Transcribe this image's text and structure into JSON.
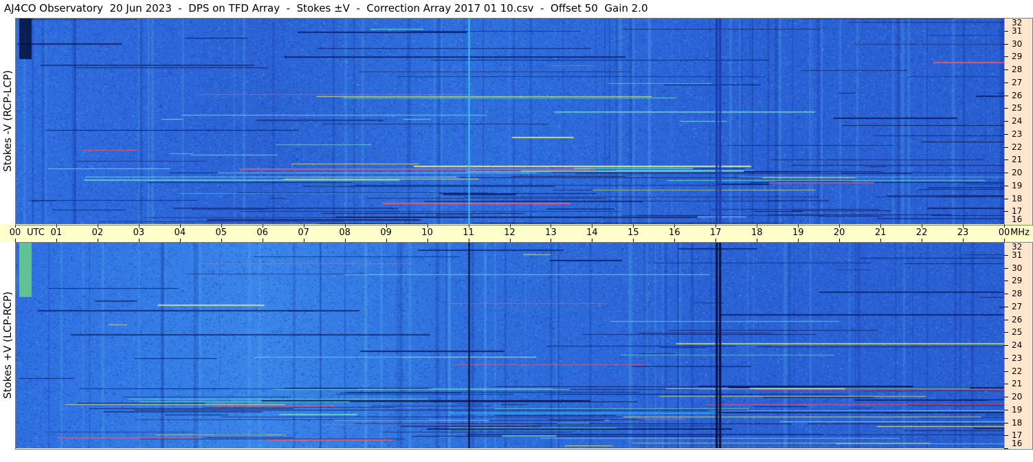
{
  "window": {
    "title": "AJ4CO Observatory  20 Jun 2023  -  DPS on TFD Array  -  Stokes ±V  -  Correction Array 2017 01 10.csv  -  Offset 50  Gain 2.0"
  },
  "chart_data": [
    {
      "type": "heatmap",
      "title": "",
      "ylabel": "Stokes -V  (RCP-LCP)",
      "y_unit": "MHz",
      "ylim": [
        16,
        32
      ],
      "y_ticks": [
        32,
        31,
        30,
        29,
        28,
        27,
        26,
        25,
        24,
        23,
        22,
        21,
        20,
        19,
        18,
        17,
        16
      ],
      "x_unit": "UTC",
      "xlim": [
        "00",
        "00"
      ],
      "colormap": [
        "#0a1a6e",
        "#1e4fd0",
        "#2f7fe8",
        "#23b8e8",
        "#70f0c0",
        "#f0f070",
        "#ff4060"
      ]
    },
    {
      "type": "heatmap",
      "title": "",
      "ylabel": "Stokes +V  (LCP-RCP)",
      "y_unit": "MHz",
      "ylim": [
        16,
        32
      ],
      "y_ticks": [
        32,
        31,
        30,
        29,
        28,
        27,
        26,
        25,
        24,
        23,
        22,
        21,
        20,
        19,
        18,
        17,
        16
      ],
      "x_unit": "UTC",
      "xlim": [
        "00",
        "00"
      ],
      "colormap": [
        "#0a1a6e",
        "#1e4fd0",
        "#2f7fe8",
        "#23b8e8",
        "#70f0c0",
        "#f0f070",
        "#ff4060"
      ]
    }
  ],
  "time_axis": {
    "labels": [
      "00",
      "01",
      "02",
      "03",
      "04",
      "05",
      "06",
      "07",
      "08",
      "09",
      "10",
      "11",
      "12",
      "13",
      "14",
      "15",
      "16",
      "17",
      "18",
      "19",
      "20",
      "21",
      "22",
      "23",
      "00"
    ],
    "utc_label": "UTC",
    "mhz_label": "MHz"
  },
  "colors": {
    "band": "#ffffcc",
    "scale_bg": "#ffe6cc",
    "accent": "#2f73e0"
  }
}
